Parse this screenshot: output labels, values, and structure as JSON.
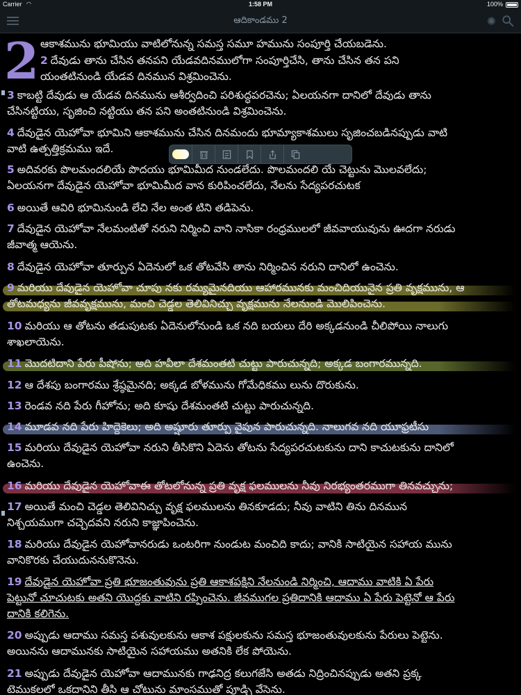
{
  "status_bar": {
    "carrier": "Carrier",
    "time": "1:58 PM",
    "battery": "100%"
  },
  "nav": {
    "title": "ఆదికాండము 2",
    "icons": [
      "menu-icon",
      "brightness-icon",
      "search-icon"
    ]
  },
  "chapter_number": "2",
  "highlight_colors": {
    "yellow": "#6b6b2a",
    "green": "#59662b",
    "blue": "#4c5a78",
    "red": "#7a3040"
  },
  "popup": {
    "icons": [
      "highlight-color-icon",
      "trash-icon",
      "note-icon",
      "bookmark-icon",
      "share-icon",
      "copy-icon"
    ]
  },
  "verses": [
    {
      "lines": [
        "ఆకాశమును భూమియు వాటిలోనున్న సమస్త సమూ హమును సంపూర్తి చేయబడెను."
      ]
    },
    {
      "num": "2",
      "lines": [
        "దేవుడు తాను చేసిన తనపని యేడవదినములోగా సంపూర్తిచేసి, తాను చేసిన తన పని",
        "యంతటినుండి యేడవ దినమున విశ్రమించెను."
      ]
    },
    {
      "num": "3",
      "lines": [
        "కాబట్టి దేవుడు ఆ యేడవ దినమును ఆశీర్వదించి పరిశుద్ధపరచెను; ఏలయనగా దానిలో దేవుడు తాను",
        "చేసినట్టియు, సృజించి నట్టియు తన పని అంతటినుండి విశ్రమించెను."
      ]
    },
    {
      "num": "4",
      "lines": [
        "దేవుడైన యెహోవా భూమిని ఆకాశమును చేసిన దినమందు భూమ్యాకాశములు సృజించబడినప్పుడు వాటి",
        "వాటి ఉత్పత్తిక్రమము ఇదే."
      ]
    },
    {
      "num": "5",
      "lines": [
        "అదివరకు పొలమందలియే పొదయు భూమిమీద నుండలేదు. పొలమందలి యే చెట్టును మొలవలేదు;",
        "ఏలయనగా దేవుడైన యెహోవా భూమిమీద వాన కురిపించలేదు, నేలను సేద్యపరచుటక"
      ]
    },
    {
      "num": "6",
      "lines": [
        "అయితే ఆవిరి భూమినుండి లేచి నేల అంత టిని తడిపెను."
      ]
    },
    {
      "num": "7",
      "lines": [
        "దేవుడైన యెహోవా నేలమంటితో నరుని నిర్మించి వాని నాసికా రంధ్రములలో జీవవాయువును ఊదగా నరుడు",
        "జీవాత్మ ఆయెను."
      ]
    },
    {
      "num": "8",
      "lines": [
        "దేవుడైన యెహోవా తూర్పున ఏదెనులో ఒక తోటవేసి తాను నిర్మించిన నరుని దానిలో ఉంచెను."
      ]
    },
    {
      "num": "9",
      "lines": [
        "మరియు దేవుడైన యెహోవా చూపు నకు రమ్యమైనదియు ఆహారమునకు మంచిదియునైన ప్రతి వృక్షమును, ఆ",
        "తోటమధ్యను జీవవృక్షమును, మంచి చెడ్డల తెలివినిచ్చు వృక్షమును నేలనుండి మొలిపించెను."
      ]
    },
    {
      "num": "10",
      "lines": [
        "మరియు ఆ తోటను తడుపుటకు ఏదెనులోనుండి ఒక నది బయలు దేరి అక్కడనుండి చీలిపోయి నాలుగు",
        "శాఖలాయెను."
      ]
    },
    {
      "num": "11",
      "lines": [
        "మొదటిదాని పేరు పీషోను; అది హవీలా దేశమంతటి చుట్టు పారుచున్నది; అక్కడ బంగారమున్నది."
      ]
    },
    {
      "num": "12",
      "lines": [
        "ఆ దేశపు బంగారము శ్రేష్ఠమైనది; అక్కడ బోళమును గోమేధికము లును దొరుకును."
      ]
    },
    {
      "num": "13",
      "lines": [
        "రెండవ నది పేరు గీహోను; అది కూషు దేశమంతటి చుట్టు పారుచున్నది."
      ]
    },
    {
      "num": "14",
      "lines": [
        "మూడవ నది పేరు హిద్దెకెలు; అది అష్షూరు తూర్పు వైపున పారుచున్నది. నాలుగవ నది యూఫ్రటీసు"
      ]
    },
    {
      "num": "15",
      "lines": [
        "మరియు దేవుడైన యెహోవా నరుని తీసికొని ఏదెను తోటను సేద్యపరచుటకును దాని కాచుటకును దానిలో",
        "ఉంచెను."
      ]
    },
    {
      "num": "16",
      "lines": [
        "మరియు దేవుడైన యెహోవాఈ తోటలోనున్న ప్రతి వృక్ష ఫలములను నీవు నిరభ్యంతరముగా తినవచ్చును;"
      ]
    },
    {
      "num": "17",
      "lines": [
        "అయితే మంచి చెడ్డల తెలివినిచ్చు వృక్ష ఫలములను తినకూడదు; నీవు వాటిని తిను దినమున",
        "నిశ్చయముగా చచ్చెదవని నరుని కాజ్ఞాపించెను."
      ]
    },
    {
      "num": "18",
      "lines": [
        "మరియు దేవుడైన యెహోవానరుడు ఒంటరిగా నుండుట మంచిది కాదు; వానికి సాటియైన సహాయ మును",
        "వానికొరకు చేయుదుననుకొనెను."
      ]
    },
    {
      "num": "19",
      "lines": [
        "దేవుడైన యెహోవా ప్రతి భూజంతువును ప్రతి ఆకాశపక్షిని నేలనుండి నిర్మించి, ఆదాము వాటికి ఏ పేరు",
        "పెట్టునో చూచుటకు అతని యొద్దకు వాటిని రప్పించెను. జీవముగల ప్రతిదానికి ఆదాము ఏ పేరు పెట్టెనో ఆ పేరు",
        "దానికి కలిగెను."
      ]
    },
    {
      "num": "20",
      "lines": [
        "అప్పుడు ఆదాము సమస్త పశువులకును ఆకాశ పక్షులకును సమస్త భూజంతువులకును పేరులు పెట్టెను.",
        "అయినను ఆదామునకు సాటియైన సహాయము అతనికి లేక పోయెను."
      ]
    },
    {
      "num": "21",
      "lines": [
        "అప్పుడు దేవుడైన యెహోవా ఆదామునకు గాఢనిద్ర కలుగజేసి అతడు నిద్రించినప్పుడు అతని ప్రక్క",
        "టెముకలలో ఒకదానిని తీసి ఆ చోటును మాంసముతో పూడ్చి వేసెను."
      ]
    }
  ]
}
